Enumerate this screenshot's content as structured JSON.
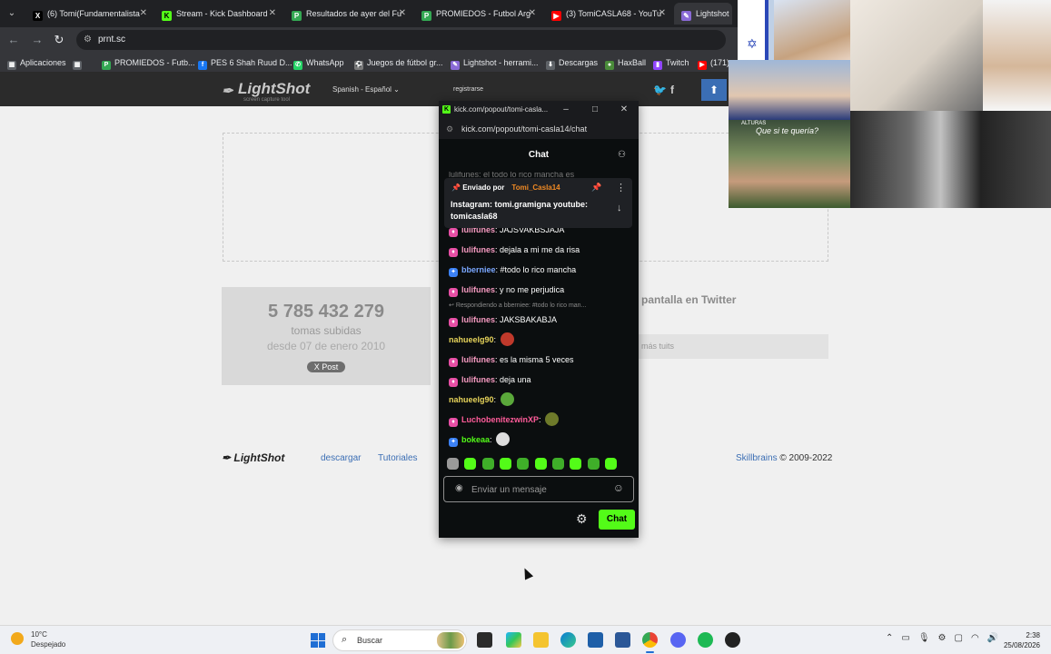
{
  "browser": {
    "tabs": [
      {
        "title": "(6) Tomi(Fundamentalista",
        "color": "#000000",
        "icon": "x-icon"
      },
      {
        "title": "Stream - Kick Dashboard",
        "color": "#53fc18",
        "icon": "kick-icon"
      },
      {
        "title": "Resultados de ayer del Fu",
        "color": "#34a853",
        "icon": "promiedos-icon"
      },
      {
        "title": "PROMIEDOS - Futbol Arg",
        "color": "#34a853",
        "icon": "promiedos-icon"
      },
      {
        "title": "(3) TomiCASLA68 - YouTu",
        "color": "#ff0000",
        "icon": "youtube-icon"
      },
      {
        "title": "Lightshot",
        "color": "#8a6ad6",
        "icon": "lightshot-icon"
      }
    ],
    "url": "prnt.sc",
    "bookmarks": [
      {
        "label": "Aplicaciones",
        "icon": "apps-icon"
      },
      {
        "label": "PROMIEDOS - Futb...",
        "icon": "promiedos-icon"
      },
      {
        "label": "PES 6 Shah Ruud D...",
        "icon": "facebook-icon"
      },
      {
        "label": "WhatsApp",
        "icon": "whatsapp-icon"
      },
      {
        "label": "Juegos de fútbol gr...",
        "icon": "juegos-icon"
      },
      {
        "label": "Lightshot - herrami...",
        "icon": "lightshot-icon"
      },
      {
        "label": "Descargas",
        "icon": "download-icon"
      },
      {
        "label": "HaxBall",
        "icon": "haxball-icon"
      },
      {
        "label": "Twitch",
        "icon": "twitch-icon"
      },
      {
        "label": "(171)",
        "icon": "youtube-icon"
      }
    ]
  },
  "lightshot": {
    "logo": "LightShot",
    "tagline": "screen capture tool",
    "language": "Spanish - Español",
    "register": "registrarse",
    "count": "5 785 432 279",
    "count_label": "tomas subidas",
    "since": "desde 07 de enero 2010",
    "post_button": "X Post",
    "twitter_title": "pantalla en Twitter",
    "twitter_link": "más tuits",
    "footer_logo": "LightShot",
    "footer_links": [
      "descargar",
      "Tutoriales"
    ],
    "copyright_brand": "Skillbrains",
    "copyright_rest": " © 2009-2022"
  },
  "kick": {
    "window_title": "kick.com/popout/tomi-casla...",
    "url": "kick.com/popout/tomi-casla14/chat",
    "chat_title": "Chat",
    "partial_top": "lulifunes: el todo lo rico mancha es",
    "pinned_by_label": "Enviado por",
    "pinned_user": "Tomi_Casla14",
    "pinned_text": "Instagram: tomi.gramigna youtube: tomicasla68",
    "reply_context": "Respondiendo a bberniee: #todo lo rico man...",
    "messages": [
      {
        "user": "lulifunes",
        "text": "JAJSVAKBSJAJA",
        "badge": "pink",
        "color": "#f59ac0"
      },
      {
        "user": "lulifunes",
        "text": "dejala a mi me da risa",
        "badge": "pink",
        "color": "#f59ac0"
      },
      {
        "user": "bberniee",
        "text": "#todo lo rico mancha",
        "badge": "blue",
        "color": "#7aa7ff"
      },
      {
        "user": "lulifunes",
        "text": "y no me perjudica",
        "badge": "pink",
        "color": "#f59ac0"
      },
      {
        "user": "lulifunes",
        "text": "JAKSBAKABJA",
        "badge": "pink",
        "color": "#f59ac0"
      },
      {
        "user": "nahueelg90",
        "text": "",
        "badge": "",
        "color": "#e6d35a",
        "emote": "#c0392b"
      },
      {
        "user": "lulifunes",
        "text": "es la misma 5 veces",
        "badge": "pink",
        "color": "#f59ac0"
      },
      {
        "user": "lulifunes",
        "text": "deja una",
        "badge": "pink",
        "color": "#f59ac0"
      },
      {
        "user": "nahueelg90",
        "text": "",
        "badge": "",
        "color": "#e6d35a",
        "emote": "#5aa83a"
      },
      {
        "user": "LuchobenitezwinXP",
        "text": "",
        "badge": "pink",
        "color": "#ff5c9a",
        "emote": "#6e7a2a"
      },
      {
        "user": "bokeaa",
        "text": "",
        "badge": "blue",
        "color": "#53fc18",
        "emote": "#dddddd"
      }
    ],
    "input_placeholder": "Enviar un mensaje",
    "send_label": "Chat"
  },
  "webcams": {
    "meme_text": "Que si te quería?",
    "meme_small": "ALTURAS"
  },
  "taskbar": {
    "temperature": "10°C",
    "weather": "Despejado",
    "search_label": "Buscar",
    "time": "2:38",
    "date": "25/08/2026"
  }
}
